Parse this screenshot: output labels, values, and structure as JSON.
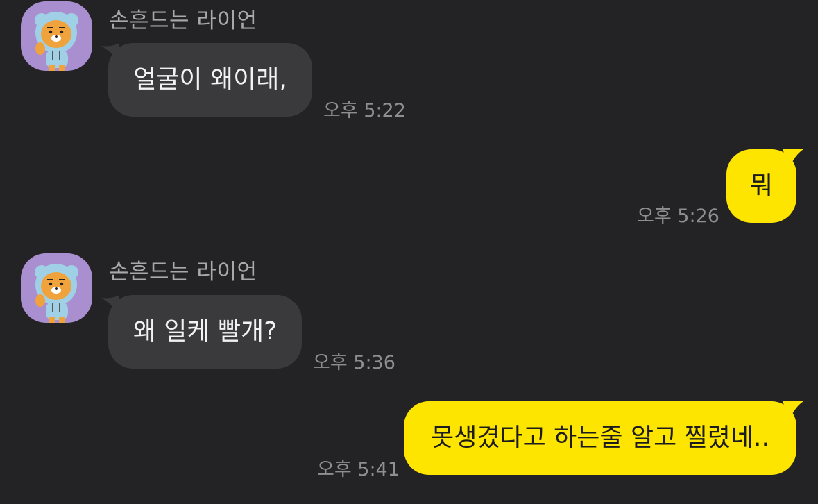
{
  "messages": [
    {
      "sender": "손흔드는 라이언",
      "text": "얼굴이 왜이래,",
      "time": "오후 5:22",
      "direction": "in"
    },
    {
      "text": "뭐",
      "time": "오후 5:26",
      "direction": "out"
    },
    {
      "sender": "손흔드는 라이언",
      "text": "왜 일케 빨개?",
      "time": "오후 5:36",
      "direction": "in"
    },
    {
      "text": "못생겼다고 하는줄 알고 찔렸네..",
      "time": "오후 5:41",
      "direction": "out"
    }
  ],
  "avatar_icon": "ryan-bear-avatar-icon",
  "colors": {
    "background": "#232325",
    "incoming_bubble": "#3a3a3c",
    "outgoing_bubble": "#fee500",
    "avatar_bg": "#a98fd0"
  }
}
